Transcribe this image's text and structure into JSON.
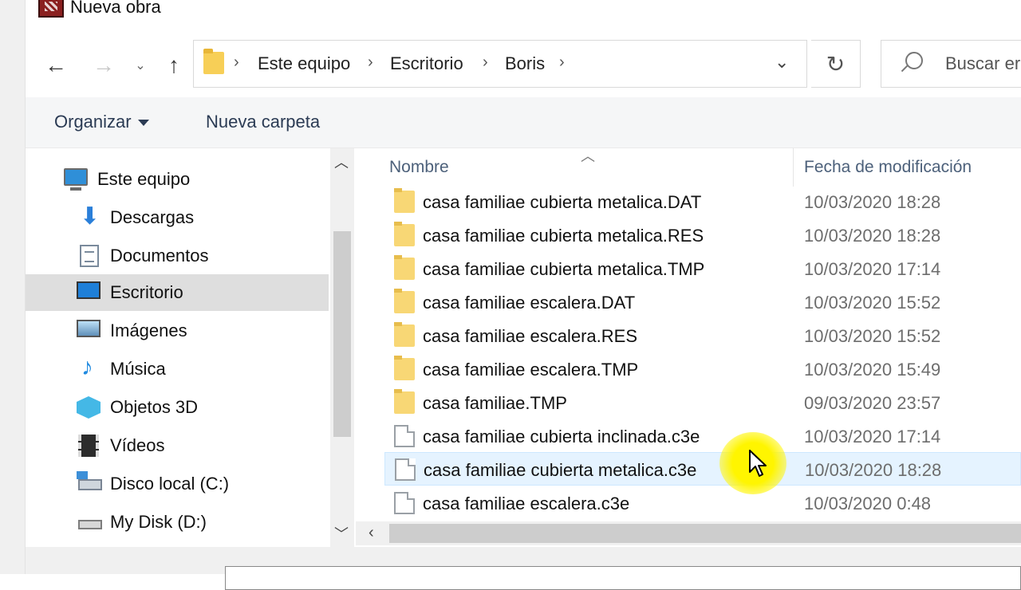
{
  "window": {
    "title": "Nueva obra"
  },
  "navigation": {
    "back_icon": "back-arrow-icon",
    "forward_icon": "forward-arrow-icon",
    "recent_icon": "chevron-down-icon",
    "up_icon": "up-arrow-icon",
    "breadcrumbs": [
      "Este equipo",
      "Escritorio",
      "Boris"
    ],
    "refresh_icon": "refresh-icon",
    "search_placeholder": "Buscar er"
  },
  "commands": {
    "organize_label": "Organizar",
    "new_folder_label": "Nueva carpeta"
  },
  "sidebar": {
    "items": [
      {
        "label": "Este equipo",
        "icon": "computer-icon"
      },
      {
        "label": "Descargas",
        "icon": "download-icon"
      },
      {
        "label": "Documentos",
        "icon": "document-icon"
      },
      {
        "label": "Escritorio",
        "icon": "desktop-icon",
        "selected": true
      },
      {
        "label": "Imágenes",
        "icon": "picture-icon"
      },
      {
        "label": "Música",
        "icon": "music-icon"
      },
      {
        "label": "Objetos 3D",
        "icon": "cube-icon"
      },
      {
        "label": "Vídeos",
        "icon": "video-icon"
      },
      {
        "label": "Disco local (C:)",
        "icon": "drive-icon"
      },
      {
        "label": "My Disk (D:)",
        "icon": "drive-icon"
      }
    ]
  },
  "columns": {
    "name": "Nombre",
    "date": "Fecha de modificación"
  },
  "files": [
    {
      "name": "casa familiae cubierta metalica.DAT",
      "date": "10/03/2020 18:28",
      "type": "folder"
    },
    {
      "name": "casa familiae cubierta metalica.RES",
      "date": "10/03/2020 18:28",
      "type": "folder"
    },
    {
      "name": "casa familiae cubierta metalica.TMP",
      "date": "10/03/2020 17:14",
      "type": "folder"
    },
    {
      "name": "casa familiae escalera.DAT",
      "date": "10/03/2020 15:52",
      "type": "folder"
    },
    {
      "name": "casa familiae escalera.RES",
      "date": "10/03/2020 15:52",
      "type": "folder"
    },
    {
      "name": "casa familiae escalera.TMP",
      "date": "10/03/2020 15:49",
      "type": "folder"
    },
    {
      "name": "casa familiae.TMP",
      "date": "09/03/2020 23:57",
      "type": "folder"
    },
    {
      "name": "casa familiae cubierta inclinada.c3e",
      "date": "10/03/2020 17:14",
      "type": "file"
    },
    {
      "name": "casa familiae cubierta metalica.c3e",
      "date": "10/03/2020 18:28",
      "type": "file",
      "hover": true
    },
    {
      "name": "casa familiae escalera.c3e",
      "date": "10/03/2020 0:48",
      "type": "file"
    }
  ],
  "colors": {
    "accent": "#1e7fd8",
    "folder": "#f8d775",
    "hover_row": "#e5f3ff",
    "cursor_highlight": "#fff500"
  }
}
